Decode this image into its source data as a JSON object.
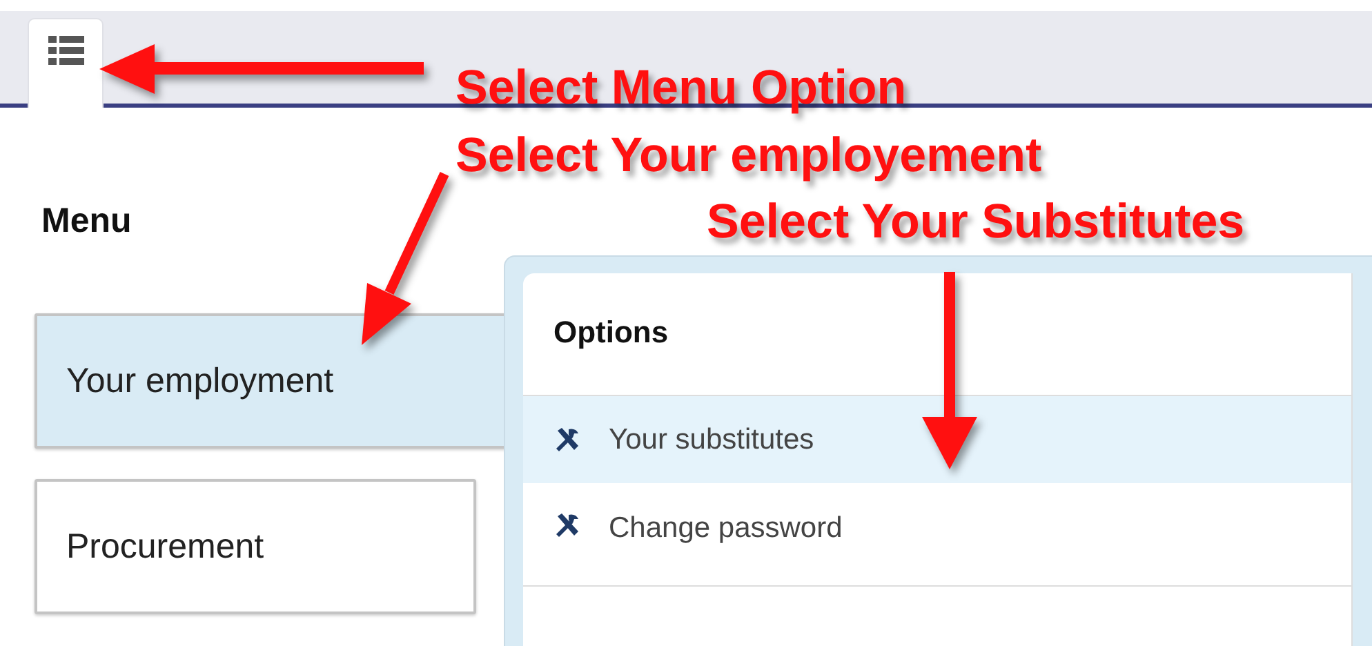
{
  "menu": {
    "title": "Menu",
    "items": [
      {
        "label": "Your employment",
        "selected": true
      },
      {
        "label": "Procurement",
        "selected": false
      }
    ]
  },
  "options": {
    "title": "Options",
    "items": [
      {
        "label": "Your substitutes",
        "selected": true
      },
      {
        "label": "Change password",
        "selected": false
      }
    ]
  },
  "annotations": [
    {
      "text": "Select Menu Option"
    },
    {
      "text": "Select Your employement"
    },
    {
      "text": "Select Your Substitutes"
    }
  ]
}
